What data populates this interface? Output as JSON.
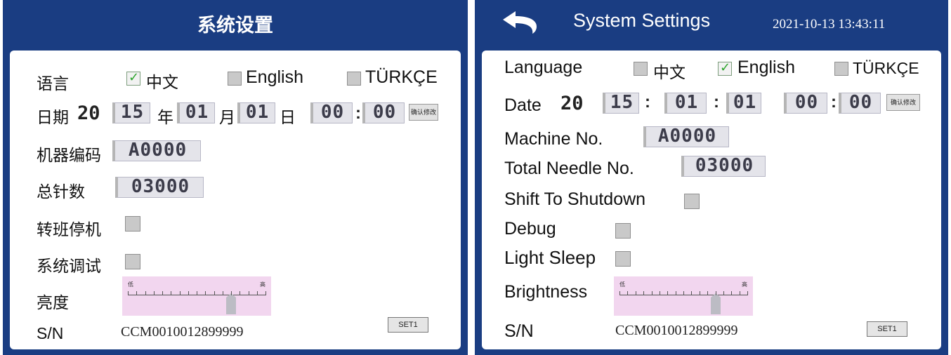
{
  "left": {
    "title": "系统设置",
    "language_label": "语言",
    "languages": [
      {
        "label": "中文",
        "checked": true
      },
      {
        "label": "English",
        "checked": false
      },
      {
        "label": "TÜRKÇE",
        "checked": false
      }
    ],
    "date_label": "日期",
    "date_prefix": "20",
    "year": "15",
    "year_suffix": "年",
    "month": "01",
    "month_suffix": "月",
    "day": "01",
    "day_suffix": "日",
    "hour": "00",
    "time_sep": ":",
    "minute": "00",
    "confirm_label": "确认修改",
    "machine_label": "机器编码",
    "machine_value": "A0000",
    "needle_label": "总针数",
    "needle_value": "03000",
    "shift_label": "转班停机",
    "shift_checked": false,
    "debug_label": "系统调试",
    "debug_checked": false,
    "brightness_label": "亮度",
    "brightness_low": "低",
    "brightness_high": "高",
    "brightness_level": 0.75,
    "sn_label": "S/N",
    "sn_value": "CCM0010012899999",
    "set_label": "SET1"
  },
  "right": {
    "title": "System Settings",
    "datetime": "2021-10-13 13:43:11",
    "language_label": "Language",
    "languages": [
      {
        "label": "中文",
        "checked": false
      },
      {
        "label": "English",
        "checked": true
      },
      {
        "label": "TÜRKÇE",
        "checked": false
      }
    ],
    "date_label": "Date",
    "date_prefix": "20",
    "year": "15",
    "date_sep": ":",
    "month": "01",
    "day": "01",
    "hour": "00",
    "time_sep": ":",
    "minute": "00",
    "confirm_label": "确认修改",
    "machine_label": "Machine No.",
    "machine_value": "A0000",
    "needle_label": "Total Needle No.",
    "needle_value": "03000",
    "shift_label": "Shift To Shutdown",
    "shift_checked": false,
    "debug_label": "Debug",
    "debug_checked": false,
    "sleep_label": "Light Sleep",
    "sleep_checked": false,
    "brightness_label": "Brightness",
    "brightness_low": "低",
    "brightness_high": "高",
    "brightness_level": 0.75,
    "sn_label": "S/N",
    "sn_value": "CCM0010012899999",
    "set_label": "SET1"
  },
  "colors": {
    "title_bar": "#1a3d82",
    "slider_bg": "#f2d6ef",
    "check_mark": "#2ea52e"
  }
}
